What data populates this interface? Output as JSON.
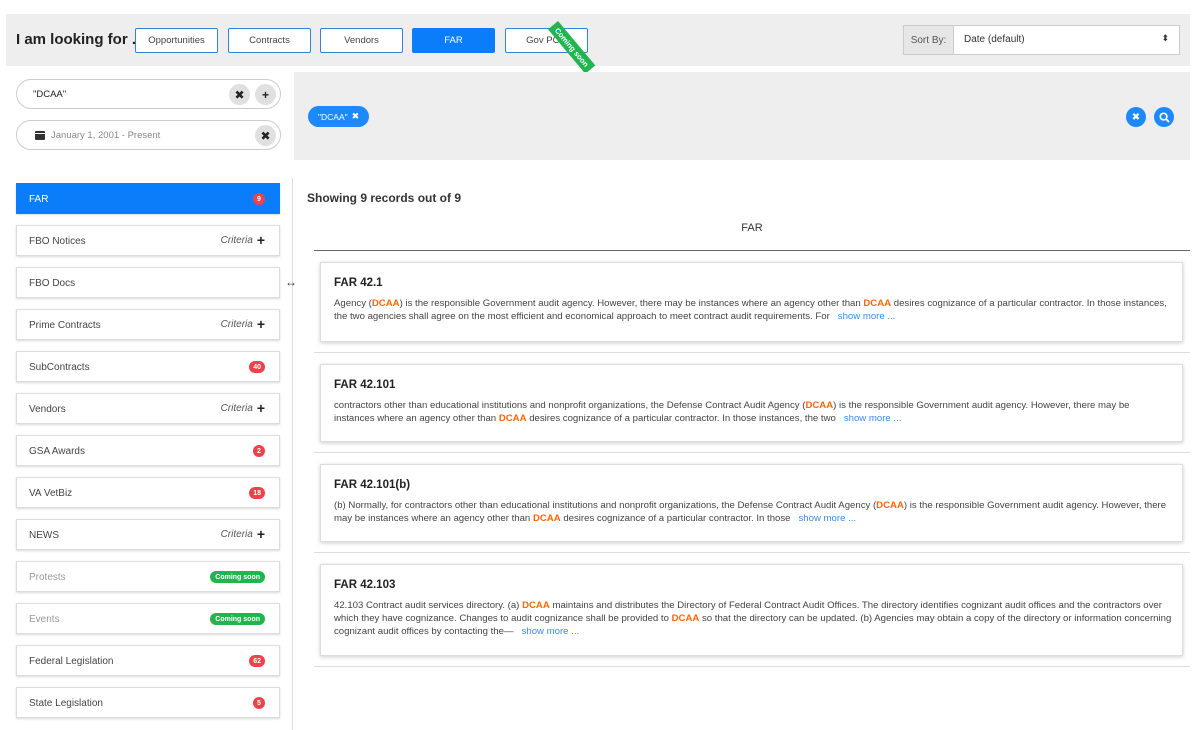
{
  "topbar": {
    "label": "I am looking for . . .",
    "categories": [
      {
        "label": "Opportunities"
      },
      {
        "label": "Contracts"
      },
      {
        "label": "Vendors"
      },
      {
        "label": "FAR"
      },
      {
        "label": "Gov POC"
      }
    ],
    "coming_soon_ribbon": "Coming soon",
    "sort_label": "Sort By:",
    "sort_value": "Date (default)",
    "sort_caret": "⬍",
    "accent": "#0a7dfa"
  },
  "search": {
    "query": "\"DCAA\"",
    "date_range": "January 1, 2001 - Present",
    "clear_glyph": "✖",
    "add_glyph": "+"
  },
  "chips": {
    "items": [
      {
        "label": "\"DCAA\"",
        "remove": "✖"
      }
    ],
    "clear_all_glyph": "✖",
    "search_glyph": "🔍"
  },
  "sidebar": {
    "items": [
      {
        "label": "FAR",
        "badge": "9"
      },
      {
        "label": "FBO Notices",
        "criteria": "Criteria",
        "plus": "+"
      },
      {
        "label": "FBO Docs"
      },
      {
        "label": "Prime Contracts",
        "criteria": "Criteria",
        "plus": "+"
      },
      {
        "label": "SubContracts",
        "badge": "40"
      },
      {
        "label": "Vendors",
        "criteria": "Criteria",
        "plus": "+"
      },
      {
        "label": "GSA Awards",
        "badge": "2"
      },
      {
        "label": "VA VetBiz",
        "badge": "18"
      },
      {
        "label": "NEWS",
        "criteria": "Criteria",
        "plus": "+"
      },
      {
        "label": "Protests",
        "soon": "Coming soon"
      },
      {
        "label": "Events",
        "soon": "Coming soon"
      },
      {
        "label": "Federal Legislation",
        "badge": "62"
      },
      {
        "label": "State Legislation",
        "badge": "5"
      }
    ],
    "resize_glyph": "↔"
  },
  "results": {
    "showing": "Showing 9 records out of 9",
    "section_title": "FAR",
    "show_more": "show more ...",
    "highlight": "DCAA",
    "cards": [
      {
        "title": "FAR 42.1",
        "parts": [
          "Agency (",
          "DCAA",
          ") is the responsible Government audit agency. However, there may be instances where an agency other than ",
          "DCAA",
          " desires cognizance of a particular contractor. In those instances, the two agencies shall agree on the most efficient and economical approach to meet contract audit requirements. For"
        ]
      },
      {
        "title": "FAR 42.101",
        "parts": [
          "contractors other than educational institutions and nonprofit organizations, the Defense Contract Audit Agency (",
          "DCAA",
          ") is the responsible Government audit agency. However, there may be instances where an agency other than ",
          "DCAA",
          " desires cognizance of a particular contractor. In those instances, the two"
        ]
      },
      {
        "title": "FAR 42.101(b)",
        "parts": [
          "(b) Normally, for contractors other than educational institutions and nonprofit organizations, the Defense Contract Audit Agency (",
          "DCAA",
          ") is the responsible Government audit agency. However, there may be instances where an agency other than ",
          "DCAA",
          " desires cognizance of a particular contractor. In those"
        ]
      },
      {
        "title": "FAR 42.103",
        "parts": [
          "42.103 Contract audit services directory. (a) ",
          "DCAA",
          " maintains and distributes the Directory of Federal Contract Audit Offices. The directory identifies cognizant audit offices and the contractors over which they have cognizance. Changes to audit cognizance shall be provided to ",
          "DCAA",
          " so that the directory can be updated. (b) Agencies may obtain a copy of the directory or information concerning cognizant audit offices by contacting the—"
        ]
      }
    ]
  }
}
